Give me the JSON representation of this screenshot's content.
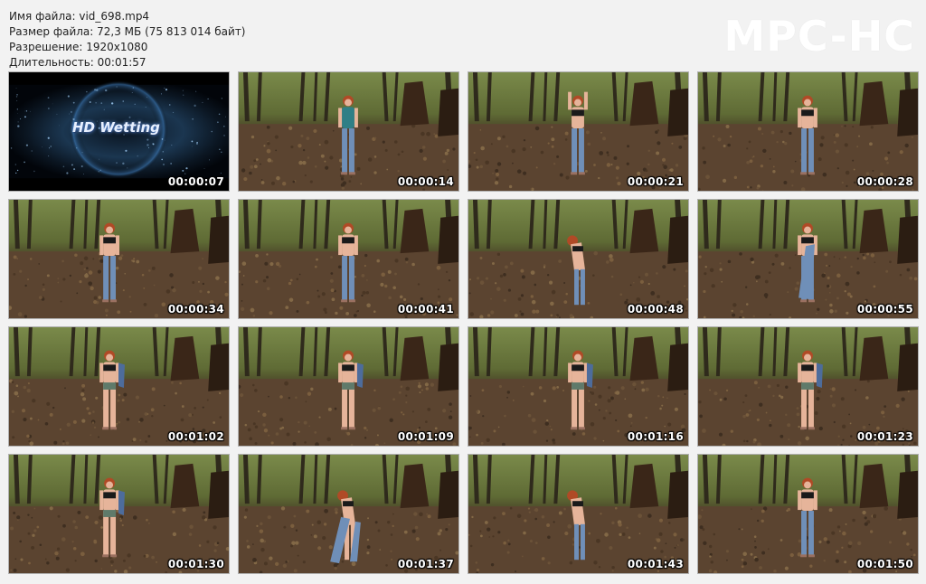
{
  "info": {
    "filename": "Имя файла: vid_698.mp4",
    "filesize": "Размер файла: 72,3 МБ (75 813 014 байт)",
    "resolution": "Разрешение: 1920x1080",
    "duration": "Длительность: 00:01:57"
  },
  "logo": "MPC-HC",
  "title_card_text": "HD Wetting",
  "thumbnails": [
    {
      "time": "00:00:07",
      "kind": "title"
    },
    {
      "time": "00:00:14",
      "kind": "scene",
      "pose": "far-teal"
    },
    {
      "time": "00:00:21",
      "kind": "scene",
      "pose": "arms-up"
    },
    {
      "time": "00:00:28",
      "kind": "scene",
      "pose": "standing"
    },
    {
      "time": "00:00:34",
      "kind": "scene",
      "pose": "standing-left"
    },
    {
      "time": "00:00:41",
      "kind": "scene",
      "pose": "standing"
    },
    {
      "time": "00:00:48",
      "kind": "scene",
      "pose": "bending"
    },
    {
      "time": "00:00:55",
      "kind": "scene",
      "pose": "holding-jeans"
    },
    {
      "time": "00:01:02",
      "kind": "scene",
      "pose": "underwear-left"
    },
    {
      "time": "00:01:09",
      "kind": "scene",
      "pose": "underwear"
    },
    {
      "time": "00:01:16",
      "kind": "scene",
      "pose": "underwear"
    },
    {
      "time": "00:01:23",
      "kind": "scene",
      "pose": "underwear"
    },
    {
      "time": "00:01:30",
      "kind": "scene",
      "pose": "underwear-left"
    },
    {
      "time": "00:01:37",
      "kind": "scene",
      "pose": "bending-jeans"
    },
    {
      "time": "00:01:43",
      "kind": "scene",
      "pose": "bending"
    },
    {
      "time": "00:01:50",
      "kind": "scene",
      "pose": "standing"
    }
  ],
  "colors": {
    "background": "#f2f2f2",
    "forest_floor": "#5a4530",
    "jeans": "#6f8fb8",
    "timestamp": "#ffffff"
  }
}
